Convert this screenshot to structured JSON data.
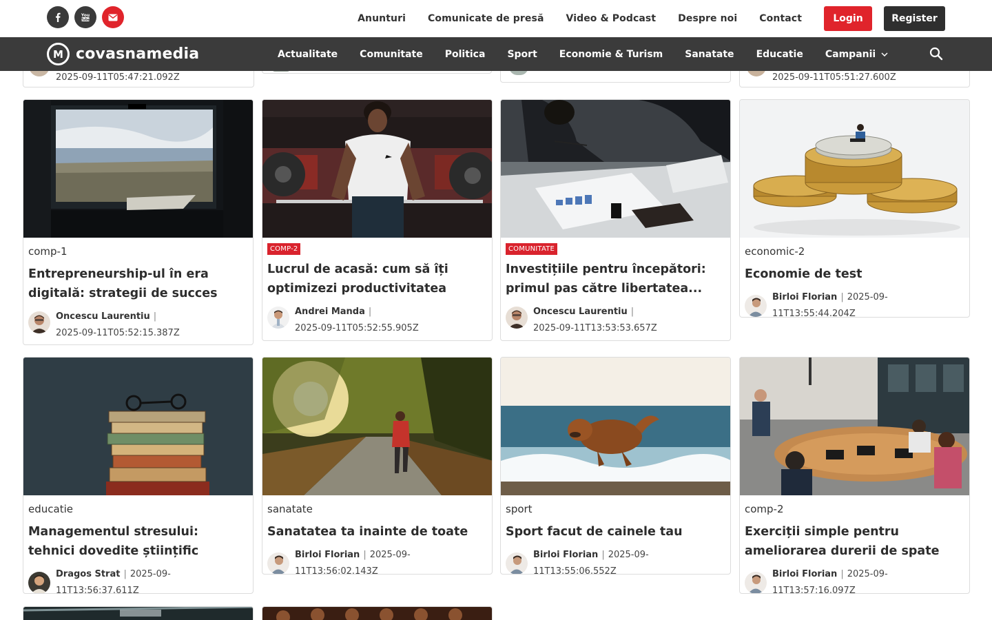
{
  "social": [
    "facebook-icon",
    "youtube-icon",
    "mail-icon"
  ],
  "top_nav": {
    "links": [
      "Anunturi",
      "Comunicate de presă",
      "Video & Podcast",
      "Despre noi",
      "Contact"
    ],
    "login": "Login",
    "register": "Register"
  },
  "brand": {
    "name": "covasnamedia",
    "mark": "M"
  },
  "main_nav": {
    "links": [
      "Actualitate",
      "Comunitate",
      "Politica",
      "Sport",
      "Economie & Turism",
      "Sanatate",
      "Educatie",
      "Campanii"
    ]
  },
  "partial_cards": [
    {
      "timestamp": "2025-09-11T05:47:21.092Z"
    },
    {
      "timestamp": ""
    },
    {
      "timestamp": ""
    },
    {
      "timestamp": "2025-09-11T05:51:27.600Z"
    }
  ],
  "cards": [
    {
      "tag": "comp-1",
      "tag_style": "plain",
      "title": "Entrepreneurship-ul în era digitală: strategii de succes",
      "author": "Oncescu Laurentiu",
      "date": "2025-09-11T05:52:15.387Z"
    },
    {
      "tag": "COMP-2",
      "tag_style": "badge",
      "title": "Lucrul de acasă: cum să îți optimizezi productivitatea",
      "author": "Andrei Manda",
      "date": "2025-09-11T05:52:55.905Z"
    },
    {
      "tag": "COMUNITATE",
      "tag_style": "badge",
      "title": "Investițiile pentru începători: primul pas către libertatea...",
      "author": "Oncescu Laurentiu",
      "date": "2025-09-11T13:53:53.657Z"
    },
    {
      "tag": "economic-2",
      "tag_style": "plain",
      "title": "Economie de test",
      "author": "Birloi Florian",
      "date": "2025-09-11T13:55:44.204Z"
    },
    {
      "tag": "educatie",
      "tag_style": "plain",
      "title": "Managementul stresului: tehnici dovedite științific",
      "author": "Dragos Strat",
      "date": "2025-09-11T13:56:37.611Z"
    },
    {
      "tag": "sanatate",
      "tag_style": "plain",
      "title": "Sanatatea ta inainte de toate",
      "author": "Birloi Florian",
      "date": "2025-09-11T13:56:02.143Z"
    },
    {
      "tag": "sport",
      "tag_style": "plain",
      "title": "Sport facut de cainele tau",
      "author": "Birloi Florian",
      "date": "2025-09-11T13:55:06.552Z"
    },
    {
      "tag": "comp-2",
      "tag_style": "plain",
      "title": "Exerciții simple pentru ameliorarea durerii de spate",
      "author": "Birloi Florian",
      "date": "2025-09-11T13:57:16.097Z"
    }
  ],
  "colors": {
    "accent": "#e0242b",
    "nav_bg": "#3b3b3b",
    "badge": "#d9232d"
  }
}
